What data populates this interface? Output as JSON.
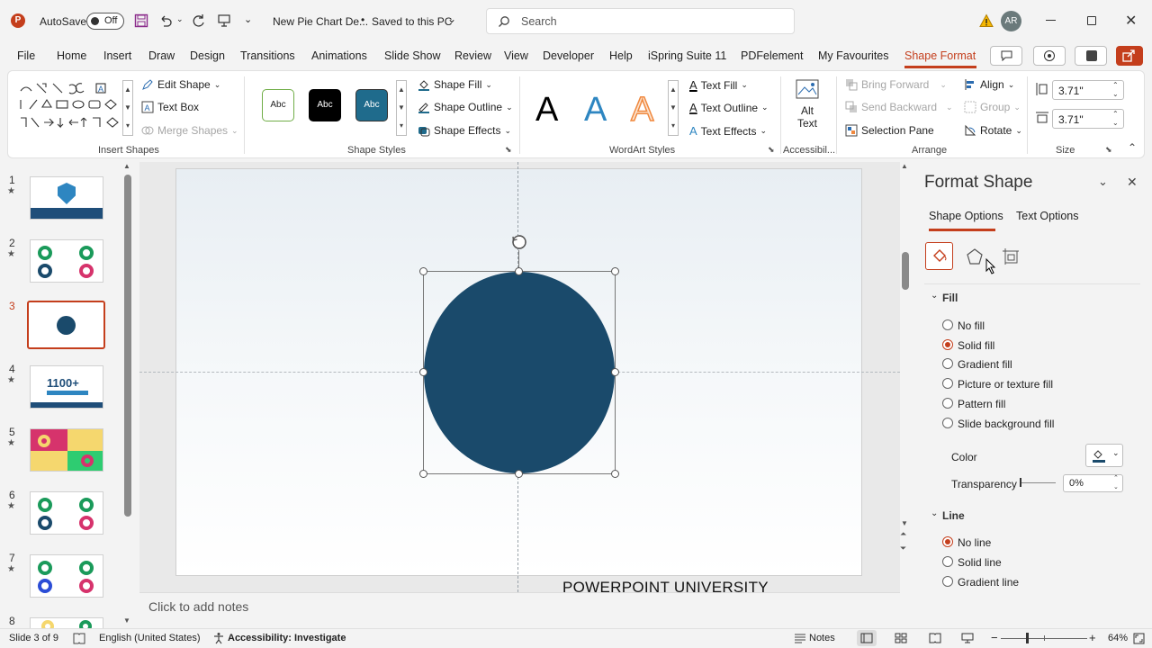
{
  "titlebar": {
    "autosave_label": "AutoSave",
    "autosave_state": "Off",
    "doc_title": "New Pie Chart De...",
    "save_status": "Saved to this PC",
    "search_placeholder": "Search",
    "user_initials": "AR"
  },
  "tabs": [
    "File",
    "Home",
    "Insert",
    "Draw",
    "Design",
    "Transitions",
    "Animations",
    "Slide Show",
    "Review",
    "View",
    "Developer",
    "Help",
    "iSpring Suite 11",
    "PDFelement",
    "My Favourites",
    "Shape Format"
  ],
  "ribbon": {
    "insert_shapes": {
      "edit_shape": "Edit Shape",
      "text_box": "Text Box",
      "merge_shapes": "Merge Shapes",
      "label": "Insert Shapes"
    },
    "shape_styles": {
      "styles": [
        "Abc",
        "Abc",
        "Abc"
      ],
      "shape_fill": "Shape Fill",
      "shape_outline": "Shape Outline",
      "shape_effects": "Shape Effects",
      "label": "Shape Styles"
    },
    "wordart": {
      "letters": [
        "A",
        "A",
        "A"
      ],
      "text_fill": "Text Fill",
      "text_outline": "Text Outline",
      "text_effects": "Text Effects",
      "label": "WordArt Styles"
    },
    "accessibility": {
      "alt_text_1": "Alt",
      "alt_text_2": "Text",
      "label": "Accessibil..."
    },
    "arrange": {
      "bring_forward": "Bring Forward",
      "send_backward": "Send Backward",
      "selection_pane": "Selection Pane",
      "align": "Align",
      "group": "Group",
      "rotate": "Rotate",
      "label": "Arrange"
    },
    "size": {
      "height": "3.71\"",
      "width": "3.71\"",
      "label": "Size"
    }
  },
  "slides": [
    {
      "num": "1",
      "star": "★"
    },
    {
      "num": "2",
      "star": "★"
    },
    {
      "num": "3",
      "star": ""
    },
    {
      "num": "4",
      "star": "★"
    },
    {
      "num": "5",
      "star": "★"
    },
    {
      "num": "6",
      "star": "★"
    },
    {
      "num": "7",
      "star": "★"
    },
    {
      "num": "8",
      "star": ""
    }
  ],
  "thumb4_text": "1100+",
  "slide": {
    "watermark": "POWERPOINT UNIVERSITY",
    "circle_color": "#1a4a6b"
  },
  "notes_placeholder": "Click to add notes",
  "format_panel": {
    "title": "Format Shape",
    "tab_shape": "Shape Options",
    "tab_text": "Text Options",
    "fill_header": "Fill",
    "fill_options": [
      "No fill",
      "Solid fill",
      "Gradient fill",
      "Picture or texture fill",
      "Pattern fill",
      "Slide background fill"
    ],
    "fill_selected": "Solid fill",
    "color_label": "Color",
    "transparency_label": "Transparency",
    "transparency_value": "0%",
    "line_header": "Line",
    "line_options": [
      "No line",
      "Solid line",
      "Gradient line"
    ],
    "line_selected": "No line"
  },
  "status": {
    "slide_count": "Slide 3 of 9",
    "language": "English (United States)",
    "accessibility": "Accessibility: Investigate",
    "notes": "Notes",
    "zoom": "64%"
  },
  "colors": {
    "accent": "#c43e1c",
    "circle": "#1a4a6b"
  }
}
